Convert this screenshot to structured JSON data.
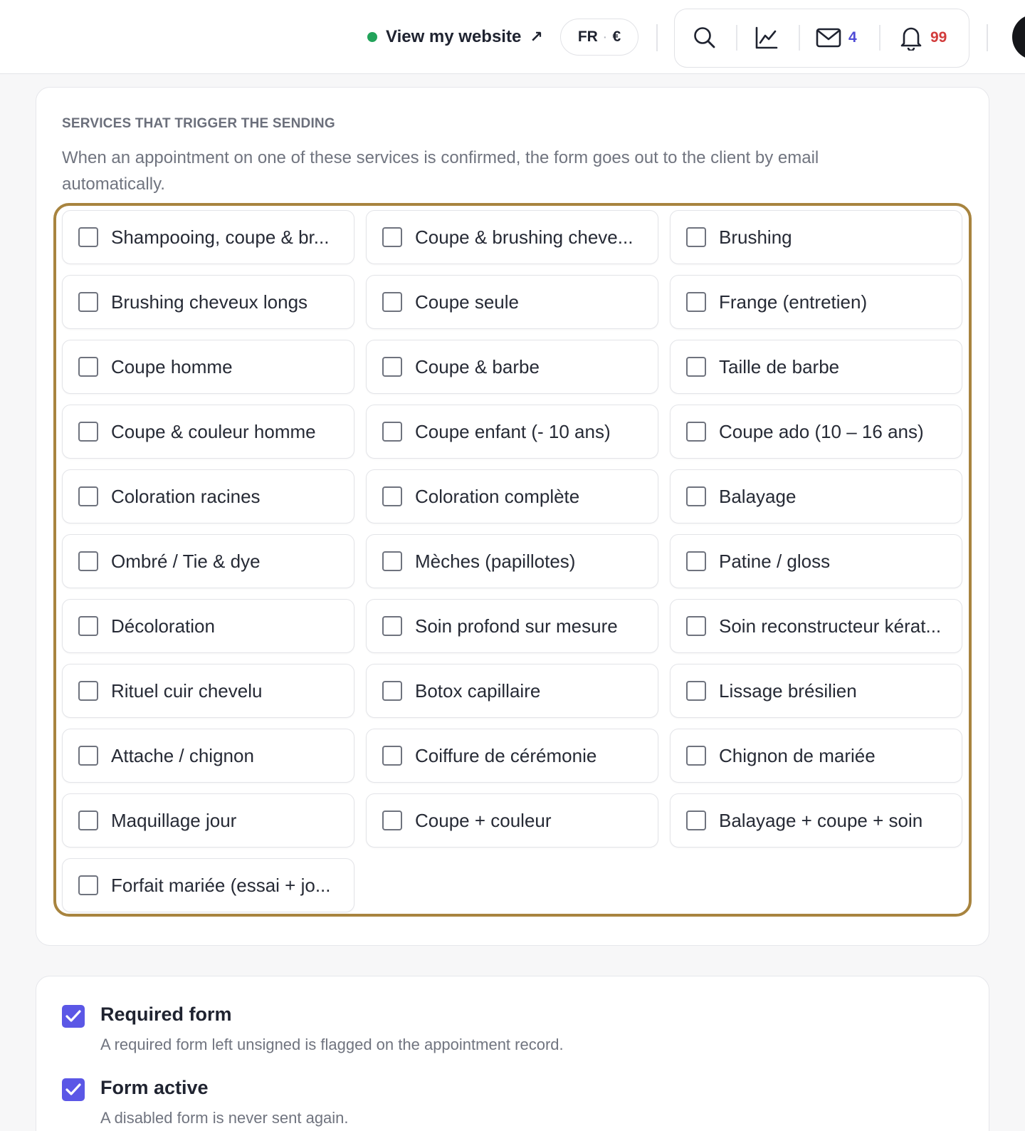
{
  "header": {
    "view_site_label": "View my website",
    "view_site_arrow": "↗",
    "locale_lang": "FR",
    "locale_sep": "·",
    "locale_currency": "€",
    "mail_count": "4",
    "notif_count": "99",
    "status_color": "#22a35a"
  },
  "services_section": {
    "title": "SERVICES THAT TRIGGER THE SENDING",
    "description": "When an appointment on one of these services is confirmed, the form goes out to the client by email automatically.",
    "highlight_color": "#a8843f",
    "services": [
      {
        "label": "Shampooing, coupe & br...",
        "checked": false
      },
      {
        "label": "Coupe & brushing cheve...",
        "checked": false
      },
      {
        "label": "Brushing",
        "checked": false
      },
      {
        "label": "Brushing cheveux longs",
        "checked": false
      },
      {
        "label": "Coupe seule",
        "checked": false
      },
      {
        "label": "Frange (entretien)",
        "checked": false
      },
      {
        "label": "Coupe homme",
        "checked": false
      },
      {
        "label": "Coupe & barbe",
        "checked": false
      },
      {
        "label": "Taille de barbe",
        "checked": false
      },
      {
        "label": "Coupe & couleur homme",
        "checked": false
      },
      {
        "label": "Coupe enfant (- 10 ans)",
        "checked": false
      },
      {
        "label": "Coupe ado (10 – 16 ans)",
        "checked": false
      },
      {
        "label": "Coloration racines",
        "checked": false
      },
      {
        "label": "Coloration complète",
        "checked": false
      },
      {
        "label": "Balayage",
        "checked": false
      },
      {
        "label": "Ombré / Tie & dye",
        "checked": false
      },
      {
        "label": "Mèches (papillotes)",
        "checked": false
      },
      {
        "label": "Patine / gloss",
        "checked": false
      },
      {
        "label": "Décoloration",
        "checked": false
      },
      {
        "label": "Soin profond sur mesure",
        "checked": false
      },
      {
        "label": "Soin reconstructeur kérat...",
        "checked": false
      },
      {
        "label": "Rituel cuir chevelu",
        "checked": false
      },
      {
        "label": "Botox capillaire",
        "checked": false
      },
      {
        "label": "Lissage brésilien",
        "checked": false
      },
      {
        "label": "Attache / chignon",
        "checked": false
      },
      {
        "label": "Coiffure de cérémonie",
        "checked": false
      },
      {
        "label": "Chignon de mariée",
        "checked": false
      },
      {
        "label": "Maquillage jour",
        "checked": false
      },
      {
        "label": "Coupe + couleur",
        "checked": false
      },
      {
        "label": "Balayage + coupe + soin",
        "checked": false
      },
      {
        "label": "Forfait mariée (essai + jo...",
        "checked": false
      }
    ]
  },
  "settings": {
    "accent_color": "#5b57e6",
    "required": {
      "title": "Required form",
      "description": "A required form left unsigned is flagged on the appointment record.",
      "checked": true
    },
    "active": {
      "title": "Form active",
      "description": "A disabled form is never sent again.",
      "checked": true
    }
  }
}
